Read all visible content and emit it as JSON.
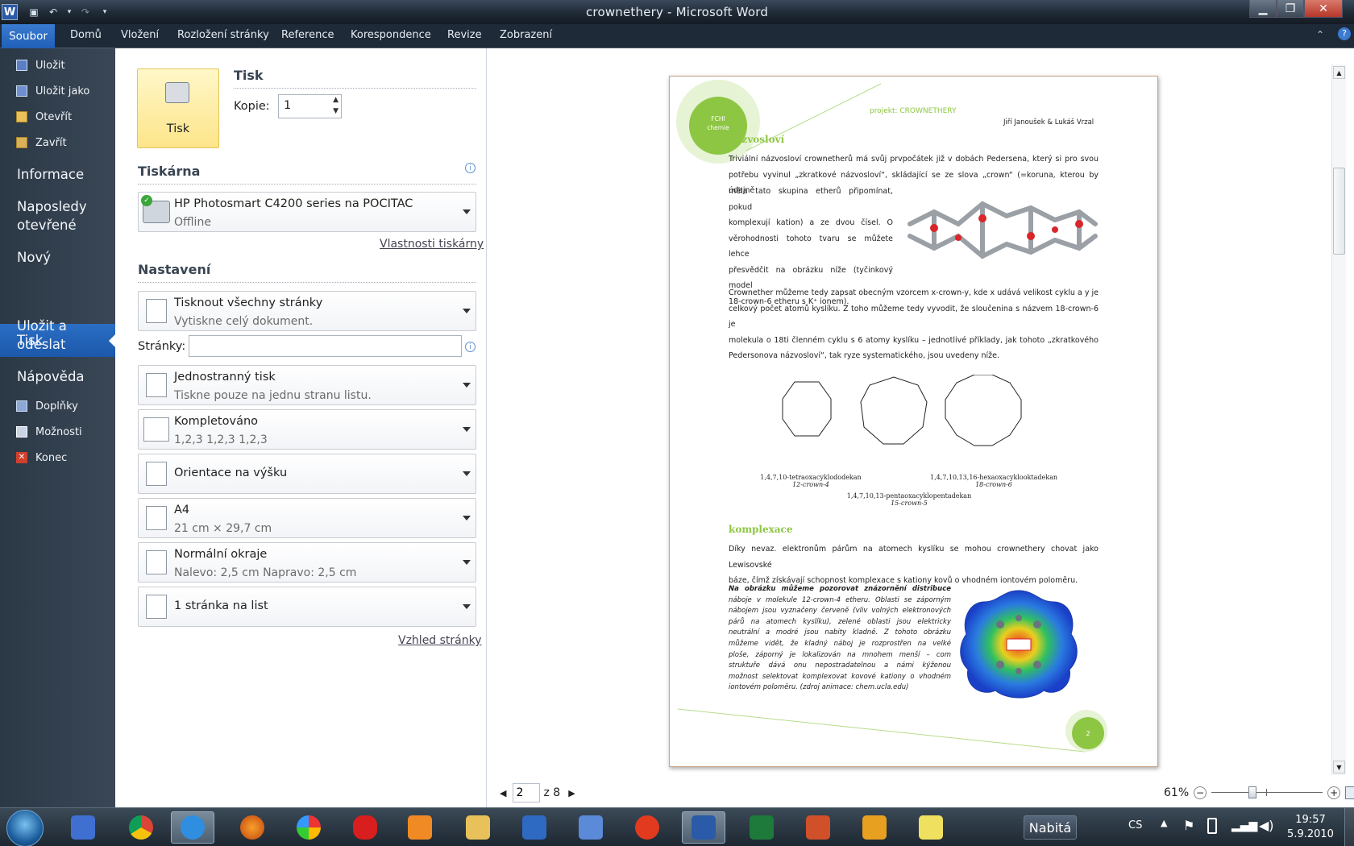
{
  "window": {
    "title_doc": "crownethery",
    "title_sep": " - ",
    "title_app": "Microsoft Word",
    "icon": "word-icon"
  },
  "ribbon": {
    "file_tab": "Soubor",
    "tabs": [
      "Domů",
      "Vložení",
      "Rozložení stránky",
      "Reference",
      "Korespondence",
      "Revize",
      "Zobrazení"
    ]
  },
  "nav": {
    "save": "Uložit",
    "save_as": "Uložit jako",
    "open": "Otevřít",
    "close": "Zavřít",
    "info": "Informace",
    "recent_1": "Naposledy",
    "recent_2": "otevřené",
    "new": "Nový",
    "print": "Tisk",
    "send_1": "Uložit a",
    "send_2": "odeslat",
    "help": "Nápověda",
    "addins": "Doplňky",
    "options": "Možnosti",
    "exit": "Konec"
  },
  "print": {
    "heading": "Tisk",
    "button": "Tisk",
    "copies_label": "Kopie:",
    "copies_value": "1",
    "printer_heading": "Tiskárna",
    "printer_name": "HP Photosmart C4200 series na POCITAC",
    "printer_status": "Offline",
    "printer_props": "Vlastnosti tiskárny",
    "settings_heading": "Nastavení",
    "pages_label": "Stránky:",
    "pages_value": "",
    "page_setup": "Vzhled stránky",
    "settings": [
      {
        "title": "Tisknout všechny stránky",
        "sub": "Vytiskne celý dokument."
      },
      {
        "title": "Jednostranný tisk",
        "sub": "Tiskne pouze na jednu stranu listu."
      },
      {
        "title": "Kompletováno",
        "sub": "1,2,3    1,2,3    1,2,3"
      },
      {
        "title": "Orientace na výšku",
        "sub": ""
      },
      {
        "title": "A4",
        "sub": "21 cm × 29,7 cm"
      },
      {
        "title": "Normální okraje",
        "sub": "Nalevo:  2,5 cm   Napravo:  2,5 cm"
      },
      {
        "title": "1 stránka na list",
        "sub": ""
      }
    ]
  },
  "preview": {
    "current_page": "2",
    "of_pages": "z 8",
    "zoom": "61%",
    "doc": {
      "logo_top": "FCHI",
      "logo_bottom": "chemie",
      "project": "projekt: CROWNETHERY",
      "authors": "Jiří Janoušek & Lukáš Vrzal",
      "h1": "názvosloví",
      "p1_lines": [
        "Triviální názvosloví crownetherů má svůj prvpočátek již v dobách Pedersena, který si pro svou",
        "potřebu vyvinul „zkratkové názvosloví“, skládající se ze slova „crown“ (=koruna, kterou by údajně"
      ],
      "p1_left_lines": [
        "měla tato skupina etherů připomínat, pokud",
        "komplexují kation) a ze dvou čísel. O",
        "věrohodnosti tohoto tvaru se můžete lehce",
        "přesvědčit na obrázku níže (tyčinkový model",
        "18-crown-6 etheru s K⁺ ionem)."
      ],
      "p2_lines": [
        "Crownether můžeme tedy zapsat obecným vzorcem x-crown-y, kde x udává velikost cyklu a y je",
        "celkový počet atomů kyslíku. Z toho můžeme tedy vyvodit, že sloučenina s názvem 18-crown-6 je",
        "molekula o 18ti členném cyklu s 6 atomy kyslíku – jednotlivé příklady, jak tohoto „zkratkového",
        "Pedersonova názvosloví“, tak ryze systematického, jsou uvedeny níže."
      ],
      "cap1a": "1,4,7,10-tetraoxacyklododekan",
      "cap1b": "12-crown-4",
      "cap2a": "1,4,7,10,13-pentaoxacyklopentadekan",
      "cap2b": "15-crown-5",
      "cap3a": "1,4,7,10,13,16-hexaoxacyklooktadekan",
      "cap3b": "18-crown-6",
      "h2": "komplexace",
      "p3_lines": [
        "Díky nevaz. elektronům párům na atomech kyslíku se mohou crownethery chovat jako Lewisovské",
        "báze, čímž získávají schopnost komplexace s kationy kovů o vhodném iontovém poloměru."
      ],
      "p4_lines": [
        "Na obrázku můžeme pozorovat znázornění distribuce",
        "náboje v molekule 12-crown-4 etheru. Oblasti se záporným",
        "nábojem jsou vyznačeny červeně (vliv volných elektronových",
        "párů na atomech kyslíku), zelené oblasti jsou elektricky",
        "neutrální a modré jsou nabity kladně. Z tohoto obrázku",
        "můžeme vidět, že kladný náboj je rozprostřen na velké",
        "ploše, záporný je lokalizován na mnohem menší – com",
        "struktuře dává onu nepostradatelnou a námi kýženou",
        "možnost selektovat komplexovat kovové kationy o vhodném",
        "iontovém poloměru.            (zdroj animace: chem.ucla.edu)"
      ],
      "page_number": "2"
    }
  },
  "taskbar": {
    "battery": "Nabitá",
    "lang": "CS",
    "time": "19:57",
    "date": "5.9.2010"
  },
  "colors": {
    "accent_blue": "#2a6ec4",
    "doc_green": "#8dc642",
    "nav_bg": "#2b3846"
  }
}
